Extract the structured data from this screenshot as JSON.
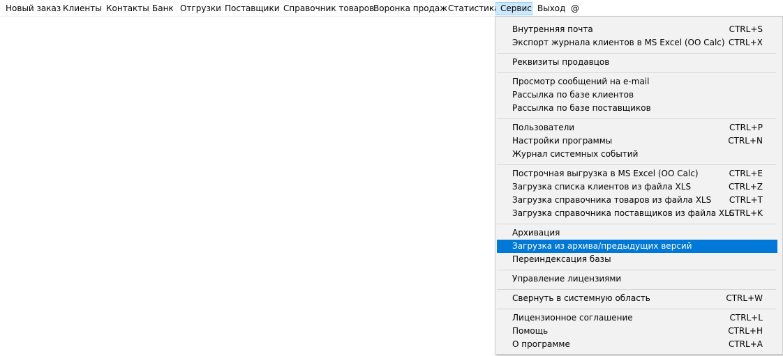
{
  "menubar": {
    "items": [
      {
        "label": "Новый заказ"
      },
      {
        "label": "Клиенты"
      },
      {
        "label": "Контакты"
      },
      {
        "label": "Банк"
      },
      {
        "label": "Отгрузки"
      },
      {
        "label": "Поставщики"
      },
      {
        "label": "Справочник товаров"
      },
      {
        "label": "Воронка продаж"
      },
      {
        "label": "Статистика"
      },
      {
        "label": "Сервис",
        "active": true
      },
      {
        "label": "Выход"
      },
      {
        "label": "@"
      }
    ]
  },
  "service_menu": {
    "items": [
      {
        "label": "Внутренняя почта",
        "shortcut": "CTRL+S"
      },
      {
        "label": "Экспорт журнала клиентов в MS Excel (OO Calc)",
        "shortcut": "CTRL+X"
      },
      {
        "label": "Реквизиты продавцов",
        "shortcut": ""
      },
      {
        "label": "Просмотр сообщений на e-mail",
        "shortcut": ""
      },
      {
        "label": "Рассылка по базе клиентов",
        "shortcut": ""
      },
      {
        "label": "Рассылка по базе поставщиков",
        "shortcut": ""
      },
      {
        "label": "Пользователи",
        "shortcut": "CTRL+P"
      },
      {
        "label": "Настройки программы",
        "shortcut": "CTRL+N"
      },
      {
        "label": "Журнал системных событий",
        "shortcut": ""
      },
      {
        "label": "Построчная выгрузка в MS Excel (OO Calc)",
        "shortcut": "CTRL+E"
      },
      {
        "label": "Загрузка списка клиентов из файла XLS",
        "shortcut": "CTRL+Z"
      },
      {
        "label": "Загрузка справочника товаров из файла XLS",
        "shortcut": "CTRL+T"
      },
      {
        "label": "Загрузка справочника поставщиков из файла XLS",
        "shortcut": "CTRL+K"
      },
      {
        "label": "Архивация",
        "shortcut": ""
      },
      {
        "label": "Загрузка из архива/предыдущих версий",
        "shortcut": "",
        "highlighted": true
      },
      {
        "label": "Переиндексация базы",
        "shortcut": ""
      },
      {
        "label": "Управление лицензиями",
        "shortcut": ""
      },
      {
        "label": "Свернуть в системную область",
        "shortcut": "CTRL+W"
      },
      {
        "label": "Лицензионное соглашение",
        "shortcut": "CTRL+L"
      },
      {
        "label": "Помощь",
        "shortcut": "CTRL+H"
      },
      {
        "label": "О программе",
        "shortcut": "CTRL+A"
      }
    ]
  },
  "colors": {
    "highlight": "#0078d7",
    "active_menubar": "#cce8ff"
  }
}
